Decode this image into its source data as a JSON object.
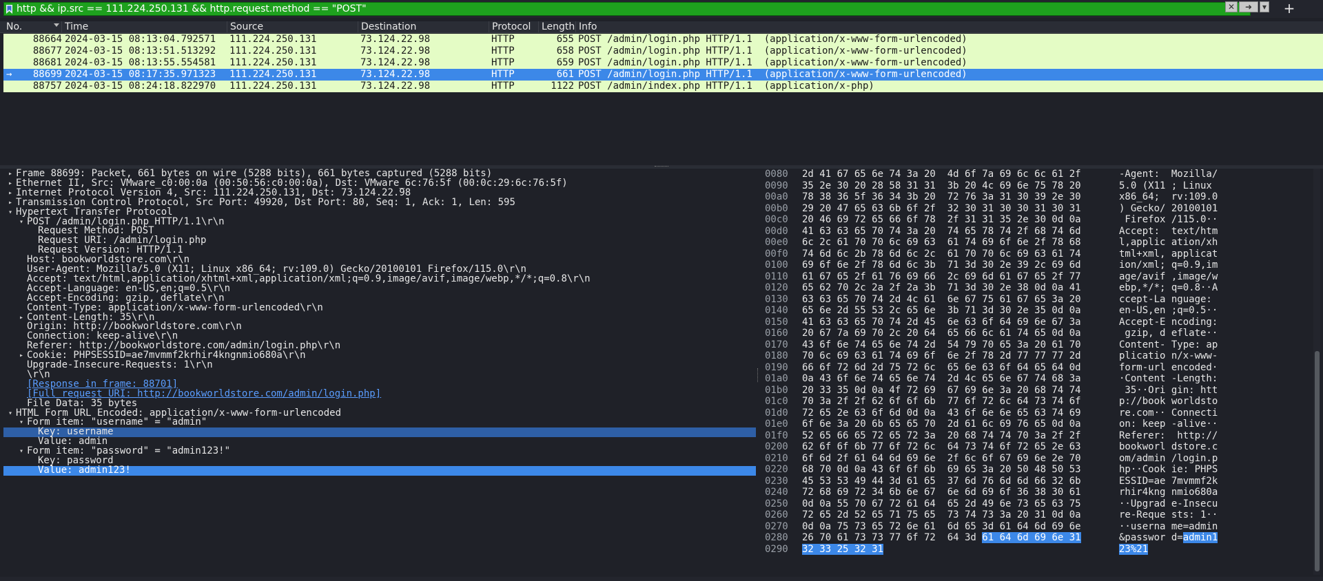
{
  "filter": {
    "value": "http && ip.src == 111.224.250.131 && http.request.method == \"POST\"",
    "clear_icon": "clear-icon",
    "apply_icon": "arrow-right-icon",
    "add_button": "+"
  },
  "columns": [
    "No.",
    "Time",
    "Source",
    "Destination",
    "Protocol",
    "Length",
    "Info"
  ],
  "packets": [
    {
      "no": "88664",
      "time": "2024-03-15 08:13:04.792571",
      "src": "111.224.250.131",
      "dst": "73.124.22.98",
      "proto": "HTTP",
      "len": "655",
      "info": "POST /admin/login.php HTTP/1.1  (application/x-www-form-urlencoded)"
    },
    {
      "no": "88677",
      "time": "2024-03-15 08:13:51.513292",
      "src": "111.224.250.131",
      "dst": "73.124.22.98",
      "proto": "HTTP",
      "len": "658",
      "info": "POST /admin/login.php HTTP/1.1  (application/x-www-form-urlencoded)"
    },
    {
      "no": "88681",
      "time": "2024-03-15 08:13:55.554581",
      "src": "111.224.250.131",
      "dst": "73.124.22.98",
      "proto": "HTTP",
      "len": "659",
      "info": "POST /admin/login.php HTTP/1.1  (application/x-www-form-urlencoded)"
    },
    {
      "no": "88699",
      "time": "2024-03-15 08:17:35.971323",
      "src": "111.224.250.131",
      "dst": "73.124.22.98",
      "proto": "HTTP",
      "len": "661",
      "info": "POST /admin/login.php HTTP/1.1  (application/x-www-form-urlencoded)"
    },
    {
      "no": "88757",
      "time": "2024-03-15 08:24:18.822970",
      "src": "111.224.250.131",
      "dst": "73.124.22.98",
      "proto": "HTTP",
      "len": "1122",
      "info": "POST /admin/index.php HTTP/1.1  (application/x-php)"
    }
  ],
  "tree": [
    {
      "indent": 0,
      "arrow": "right",
      "text": "Frame 88699: Packet, 661 bytes on wire (5288 bits), 661 bytes captured (5288 bits)"
    },
    {
      "indent": 0,
      "arrow": "right",
      "text": "Ethernet II, Src: VMware_c0:00:0a (00:50:56:c0:00:0a), Dst: VMware_6c:76:5f (00:0c:29:6c:76:5f)"
    },
    {
      "indent": 0,
      "arrow": "right",
      "text": "Internet Protocol Version 4, Src: 111.224.250.131, Dst: 73.124.22.98"
    },
    {
      "indent": 0,
      "arrow": "right",
      "text": "Transmission Control Protocol, Src Port: 49920, Dst Port: 80, Seq: 1, Ack: 1, Len: 595"
    },
    {
      "indent": 0,
      "arrow": "down",
      "text": "Hypertext Transfer Protocol"
    },
    {
      "indent": 1,
      "arrow": "down",
      "text": "POST /admin/login.php HTTP/1.1\\r\\n"
    },
    {
      "indent": 2,
      "arrow": "",
      "text": "Request Method: POST"
    },
    {
      "indent": 2,
      "arrow": "",
      "text": "Request URI: /admin/login.php"
    },
    {
      "indent": 2,
      "arrow": "",
      "text": "Request Version: HTTP/1.1"
    },
    {
      "indent": 1,
      "arrow": "",
      "text": "Host: bookworldstore.com\\r\\n"
    },
    {
      "indent": 1,
      "arrow": "",
      "text": "User-Agent: Mozilla/5.0 (X11; Linux x86_64; rv:109.0) Gecko/20100101 Firefox/115.0\\r\\n"
    },
    {
      "indent": 1,
      "arrow": "",
      "text": "Accept: text/html,application/xhtml+xml,application/xml;q=0.9,image/avif,image/webp,*/*;q=0.8\\r\\n"
    },
    {
      "indent": 1,
      "arrow": "",
      "text": "Accept-Language: en-US,en;q=0.5\\r\\n"
    },
    {
      "indent": 1,
      "arrow": "",
      "text": "Accept-Encoding: gzip, deflate\\r\\n"
    },
    {
      "indent": 1,
      "arrow": "",
      "text": "Content-Type: application/x-www-form-urlencoded\\r\\n"
    },
    {
      "indent": 1,
      "arrow": "right",
      "text": "Content-Length: 35\\r\\n"
    },
    {
      "indent": 1,
      "arrow": "",
      "text": "Origin: http://bookworldstore.com\\r\\n"
    },
    {
      "indent": 1,
      "arrow": "",
      "text": "Connection: keep-alive\\r\\n"
    },
    {
      "indent": 1,
      "arrow": "",
      "text": "Referer: http://bookworldstore.com/admin/login.php\\r\\n"
    },
    {
      "indent": 1,
      "arrow": "right",
      "text": "Cookie: PHPSESSID=ae7mvmmf2krhir4kngnmio680a\\r\\n"
    },
    {
      "indent": 1,
      "arrow": "",
      "text": "Upgrade-Insecure-Requests: 1\\r\\n"
    },
    {
      "indent": 1,
      "arrow": "",
      "text": "\\r\\n"
    },
    {
      "indent": 1,
      "arrow": "",
      "text": "[Response in frame: 88701]",
      "link": true
    },
    {
      "indent": 1,
      "arrow": "",
      "text": "[Full request URI: http://bookworldstore.com/admin/login.php]",
      "link": true
    },
    {
      "indent": 1,
      "arrow": "",
      "text": "File Data: 35 bytes"
    },
    {
      "indent": 0,
      "arrow": "down",
      "text": "HTML Form URL Encoded: application/x-www-form-urlencoded"
    },
    {
      "indent": 1,
      "arrow": "down",
      "text": "Form item: \"username\" = \"admin\""
    },
    {
      "indent": 2,
      "arrow": "",
      "text": "Key: username",
      "sel": "dim"
    },
    {
      "indent": 2,
      "arrow": "",
      "text": "Value: admin"
    },
    {
      "indent": 1,
      "arrow": "down",
      "text": "Form item: \"password\" = \"admin123!\""
    },
    {
      "indent": 2,
      "arrow": "",
      "text": "Key: password"
    },
    {
      "indent": 2,
      "arrow": "",
      "text": "Value: admin123!",
      "sel": "bright"
    }
  ],
  "hex": [
    {
      "off": "0080",
      "bytes": "2d 41 67 65 6e 74 3a 20  4d 6f 7a 69 6c 6c 61 2f",
      "ascii": "-Agent:  Mozilla/"
    },
    {
      "off": "0090",
      "bytes": "35 2e 30 20 28 58 31 31  3b 20 4c 69 6e 75 78 20",
      "ascii": "5.0 (X11 ; Linux "
    },
    {
      "off": "00a0",
      "bytes": "78 38 36 5f 36 34 3b 20  72 76 3a 31 30 39 2e 30",
      "ascii": "x86_64;  rv:109.0"
    },
    {
      "off": "00b0",
      "bytes": "29 20 47 65 63 6b 6f 2f  32 30 31 30 30 31 30 31",
      "ascii": ") Gecko/ 20100101"
    },
    {
      "off": "00c0",
      "bytes": "20 46 69 72 65 66 6f 78  2f 31 31 35 2e 30 0d 0a",
      "ascii": " Firefox /115.0··"
    },
    {
      "off": "00d0",
      "bytes": "41 63 63 65 70 74 3a 20  74 65 78 74 2f 68 74 6d",
      "ascii": "Accept:  text/htm"
    },
    {
      "off": "00e0",
      "bytes": "6c 2c 61 70 70 6c 69 63  61 74 69 6f 6e 2f 78 68",
      "ascii": "l,applic ation/xh"
    },
    {
      "off": "00f0",
      "bytes": "74 6d 6c 2b 78 6d 6c 2c  61 70 70 6c 69 63 61 74",
      "ascii": "tml+xml, applicat"
    },
    {
      "off": "0100",
      "bytes": "69 6f 6e 2f 78 6d 6c 3b  71 3d 30 2e 39 2c 69 6d",
      "ascii": "ion/xml; q=0.9,im"
    },
    {
      "off": "0110",
      "bytes": "61 67 65 2f 61 76 69 66  2c 69 6d 61 67 65 2f 77",
      "ascii": "age/avif ,image/w"
    },
    {
      "off": "0120",
      "bytes": "65 62 70 2c 2a 2f 2a 3b  71 3d 30 2e 38 0d 0a 41",
      "ascii": "ebp,*/*; q=0.8··A"
    },
    {
      "off": "0130",
      "bytes": "63 63 65 70 74 2d 4c 61  6e 67 75 61 67 65 3a 20",
      "ascii": "ccept-La nguage: "
    },
    {
      "off": "0140",
      "bytes": "65 6e 2d 55 53 2c 65 6e  3b 71 3d 30 2e 35 0d 0a",
      "ascii": "en-US,en ;q=0.5··"
    },
    {
      "off": "0150",
      "bytes": "41 63 63 65 70 74 2d 45  6e 63 6f 64 69 6e 67 3a",
      "ascii": "Accept-E ncoding:"
    },
    {
      "off": "0160",
      "bytes": "20 67 7a 69 70 2c 20 64  65 66 6c 61 74 65 0d 0a",
      "ascii": " gzip, d eflate··"
    },
    {
      "off": "0170",
      "bytes": "43 6f 6e 74 65 6e 74 2d  54 79 70 65 3a 20 61 70",
      "ascii": "Content- Type: ap"
    },
    {
      "off": "0180",
      "bytes": "70 6c 69 63 61 74 69 6f  6e 2f 78 2d 77 77 77 2d",
      "ascii": "plicatio n/x-www-"
    },
    {
      "off": "0190",
      "bytes": "66 6f 72 6d 2d 75 72 6c  65 6e 63 6f 64 65 64 0d",
      "ascii": "form-url encoded·"
    },
    {
      "off": "01a0",
      "bytes": "0a 43 6f 6e 74 65 6e 74  2d 4c 65 6e 67 74 68 3a",
      "ascii": "·Content -Length:"
    },
    {
      "off": "01b0",
      "bytes": "20 33 35 0d 0a 4f 72 69  67 69 6e 3a 20 68 74 74",
      "ascii": " 35··Ori gin: htt"
    },
    {
      "off": "01c0",
      "bytes": "70 3a 2f 2f 62 6f 6f 6b  77 6f 72 6c 64 73 74 6f",
      "ascii": "p://book worldsto"
    },
    {
      "off": "01d0",
      "bytes": "72 65 2e 63 6f 6d 0d 0a  43 6f 6e 6e 65 63 74 69",
      "ascii": "re.com·· Connecti"
    },
    {
      "off": "01e0",
      "bytes": "6f 6e 3a 20 6b 65 65 70  2d 61 6c 69 76 65 0d 0a",
      "ascii": "on: keep -alive··"
    },
    {
      "off": "01f0",
      "bytes": "52 65 66 65 72 65 72 3a  20 68 74 74 70 3a 2f 2f",
      "ascii": "Referer:  http://"
    },
    {
      "off": "0200",
      "bytes": "62 6f 6f 6b 77 6f 72 6c  64 73 74 6f 72 65 2e 63",
      "ascii": "bookworl dstore.c"
    },
    {
      "off": "0210",
      "bytes": "6f 6d 2f 61 64 6d 69 6e  2f 6c 6f 67 69 6e 2e 70",
      "ascii": "om/admin /login.p"
    },
    {
      "off": "0220",
      "bytes": "68 70 0d 0a 43 6f 6f 6b  69 65 3a 20 50 48 50 53",
      "ascii": "hp··Cook ie: PHPS"
    },
    {
      "off": "0230",
      "bytes": "45 53 53 49 44 3d 61 65  37 6d 76 6d 6d 66 32 6b",
      "ascii": "ESSID=ae 7mvmmf2k"
    },
    {
      "off": "0240",
      "bytes": "72 68 69 72 34 6b 6e 67  6e 6d 69 6f 36 38 30 61",
      "ascii": "rhir4kng nmio680a"
    },
    {
      "off": "0250",
      "bytes": "0d 0a 55 70 67 72 61 64  65 2d 49 6e 73 65 63 75",
      "ascii": "··Upgrad e-Insecu"
    },
    {
      "off": "0260",
      "bytes": "72 65 2d 52 65 71 75 65  73 74 73 3a 20 31 0d 0a",
      "ascii": "re-Reque sts: 1··"
    },
    {
      "off": "0270",
      "bytes": "0d 0a 75 73 65 72 6e 61  6d 65 3d 61 64 6d 69 6e",
      "ascii": "··userna me=admin"
    },
    {
      "off": "0280",
      "bytes_pre": "26 70 61 73 73 77 6f 72  64 3d ",
      "bytes_hl": "61 64 6d 69 6e 31",
      "ascii_pre": "&passwor d=",
      "ascii_hl": "admin1"
    },
    {
      "off": "0290",
      "bytes_pre": "",
      "bytes_hl": "32 33 25 32 31",
      "ascii_pre": "",
      "ascii_hl": "23%21"
    }
  ]
}
